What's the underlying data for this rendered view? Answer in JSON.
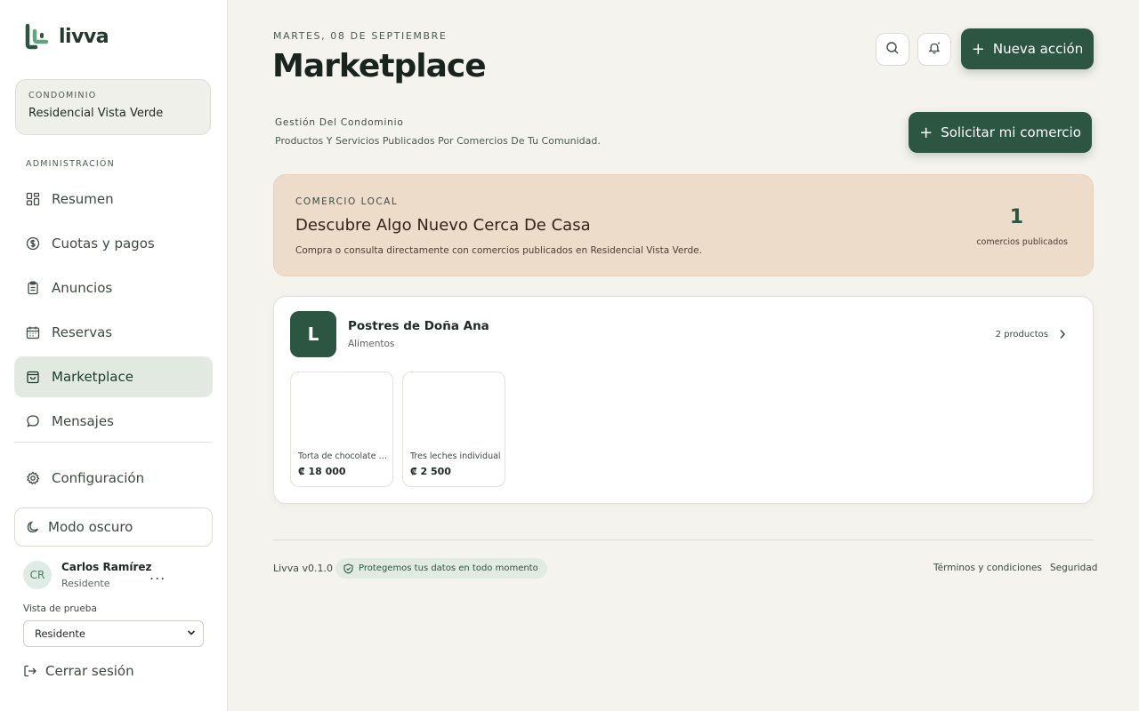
{
  "app": {
    "name": "livva"
  },
  "sidebar": {
    "condo_label": "CONDOMINIO",
    "condo_name": "Residencial Vista Verde",
    "section_label": "ADMINISTRACIÓN",
    "items": [
      {
        "label": "Resumen",
        "icon": "grid-icon",
        "active": false
      },
      {
        "label": "Cuotas y pagos",
        "icon": "dollar-circle-icon",
        "active": false
      },
      {
        "label": "Anuncios",
        "icon": "clipboard-icon",
        "active": false
      },
      {
        "label": "Reservas",
        "icon": "calendar-icon",
        "active": false
      },
      {
        "label": "Marketplace",
        "icon": "shopping-bag-icon",
        "active": true
      },
      {
        "label": "Mensajes",
        "icon": "chat-bubble-icon",
        "active": false
      }
    ],
    "settings_label": "Configuración",
    "dark_mode_label": "Modo oscuro",
    "user": {
      "initials": "CR",
      "name": "Carlos Ramírez",
      "role": "Residente",
      "more": "..."
    },
    "preview_label": "Vista de prueba",
    "preview_value": "Residente",
    "logout_label": "Cerrar sesión"
  },
  "header": {
    "date": "MARTES, 08 DE SEPTIEMBRE",
    "title": "Marketplace",
    "new_action_label": "Nueva acción"
  },
  "subsection": {
    "title": "Gestión Del Condominio",
    "description": "Productos Y Servicios Publicados Por Comercios De Tu Comunidad.",
    "request_label": "Solicitar mi comercio"
  },
  "banner": {
    "label": "COMERCIO LOCAL",
    "title": "Descubre Algo Nuevo Cerca De Casa",
    "description": "Compra o consulta directamente con comercios publicados en Residencial Vista Verde.",
    "count": "1",
    "count_label": "comercios publicados"
  },
  "merchants": [
    {
      "initial": "L",
      "name": "Postres de Doña Ana",
      "category": "Alimentos",
      "products_count": "2 productos",
      "products": [
        {
          "name": "Torta de chocolate (...",
          "price": "₡ 18 000"
        },
        {
          "name": "Tres leches individual",
          "price": "₡ 2 500"
        }
      ]
    }
  ],
  "footer": {
    "version": "Livva v0.1.0",
    "secure_text": "Protegemos tus datos en todo momento",
    "terms": "Términos y condiciones",
    "security": "Seguridad"
  },
  "colors": {
    "brand": "#2c5542",
    "banner_bg": "#eedccb",
    "page_bg": "#f5f3ee"
  }
}
